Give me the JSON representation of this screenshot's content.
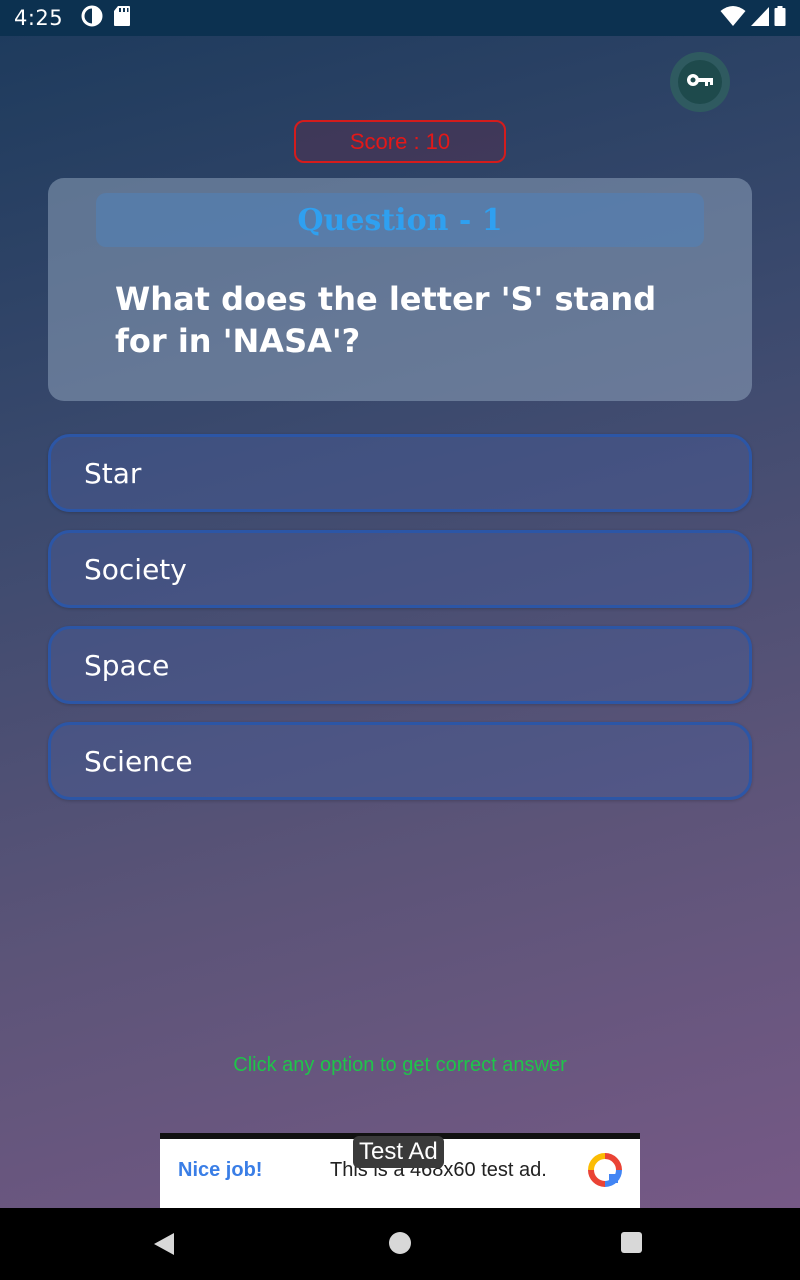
{
  "status_bar": {
    "time": "4:25",
    "left_icons": [
      "data-saver-icon",
      "sd-card-icon"
    ],
    "right_icons": [
      "wifi-icon",
      "cell-signal-icon",
      "battery-icon"
    ]
  },
  "header": {
    "score_text": "Score : 10",
    "key_button_icon": "key-icon"
  },
  "question": {
    "title": "Question - 1",
    "text": "What does the letter 'S' stand for in 'NASA'?"
  },
  "options": [
    "Star",
    "Society",
    "Space",
    "Science"
  ],
  "hint": "Click any option to get correct answer",
  "ad": {
    "tag": "Test Ad",
    "headline": "Nice job!",
    "body": "This is a 468x60 test ad.",
    "logo_icon": "ad-choices-logo-icon"
  },
  "nav_bar": {
    "icons": [
      "back-icon",
      "home-icon",
      "recents-icon"
    ]
  },
  "colors": {
    "score_red": "#e31818",
    "question_title_blue": "#2fa0f0",
    "hint_green": "#1fc44a",
    "option_border": "#2c56a6"
  }
}
